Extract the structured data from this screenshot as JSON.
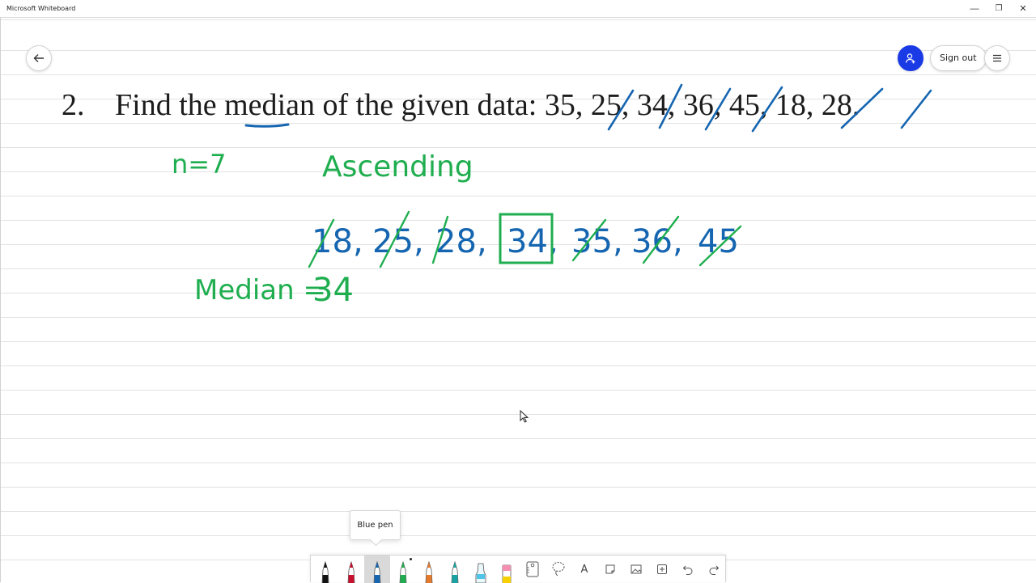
{
  "window": {
    "title": "Microsoft Whiteboard",
    "controls": {
      "minimize": "—",
      "restore": "❐",
      "close": "✕"
    }
  },
  "header": {
    "back_icon": "arrow-left-icon",
    "avatar_icon": "person-add-icon",
    "avatar_color": "#1a3ae6",
    "sign_out_label": "Sign out",
    "menu_icon": "hamburger-icon"
  },
  "problem": {
    "number": "2.",
    "text_before": "Find the ",
    "underlined": "med",
    "text_after": "ian of the given data: ",
    "data_values": [
      "35",
      "25",
      "34",
      "36",
      "45",
      "18",
      "28"
    ],
    "separator": ", ",
    "terminator": "."
  },
  "ink": {
    "green_color": "#1fae4f",
    "blue_color": "#1565b0",
    "n_label": "n=7",
    "ascending_label": "Ascending",
    "sorted_values": [
      "18",
      "25",
      "28",
      "34",
      "35",
      "36",
      "45"
    ],
    "boxed_value": "34",
    "median_label": "Median = ",
    "median_value": "34"
  },
  "tooltip": {
    "text": "Blue pen"
  },
  "toolbar": {
    "pens": [
      {
        "name": "black-pen",
        "color": "#111111"
      },
      {
        "name": "red-pen",
        "color": "#c8102e"
      },
      {
        "name": "blue-pen",
        "color": "#1565b0",
        "selected": true
      },
      {
        "name": "green-pen",
        "color": "#1fae4f"
      },
      {
        "name": "orange-pen",
        "color": "#e57a2a"
      },
      {
        "name": "teal-pen",
        "color": "#1aa3a3"
      },
      {
        "name": "highlighter",
        "color": "#4fc3e8"
      },
      {
        "name": "eraser",
        "color": "#f48fb1"
      }
    ],
    "tools": [
      "ruler-icon",
      "lasso-icon",
      "text-icon",
      "sticky-note-icon",
      "image-icon",
      "add-icon",
      "undo-icon",
      "redo-icon"
    ],
    "text_tool_label": "A"
  }
}
